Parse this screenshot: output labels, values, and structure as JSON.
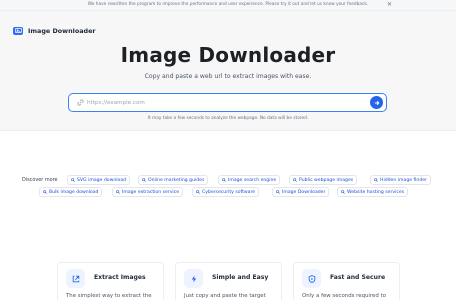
{
  "banner": {
    "text": "We have rewritten the program to improve the performance and user experience. Please try it out and let us know your feedback.",
    "close_glyph": "✕"
  },
  "header": {
    "logo_icon": "image-icon",
    "logo_text": "Image Downloader"
  },
  "hero": {
    "title": "Image Downloader",
    "subtitle": "Copy and paste a web url to extract images with ease.",
    "search": {
      "placeholder": "https://example.com",
      "value": "",
      "icon": "link-icon",
      "submit_icon": "arrow-right-icon"
    },
    "hint": "It may take a few seconds to analyze the webpage. No data will be stored."
  },
  "discover": {
    "label": "Discover more",
    "pill_icon": "search-icon",
    "items": [
      "SVG image download",
      "Online marketing guides",
      "Image search engine",
      "Public webpage images",
      "Hidden image finder",
      "Bulk image download",
      "Image extraction service",
      "Cybersecurity software",
      "Image Downloader",
      "Website hosting services"
    ]
  },
  "features": [
    {
      "icon": "extract-icon",
      "title": "Extract Images",
      "text": "The simplest way to extract the"
    },
    {
      "icon": "bolt-icon",
      "title": "Simple and Easy",
      "text": "Just copy and paste the target"
    },
    {
      "icon": "shield-icon",
      "title": "Fast and Secure",
      "text": "Only a few seconds required to"
    }
  ],
  "colors": {
    "accent": "#2563eb",
    "link": "#1d4ed8",
    "hero_bg": "#f7f7f8"
  }
}
